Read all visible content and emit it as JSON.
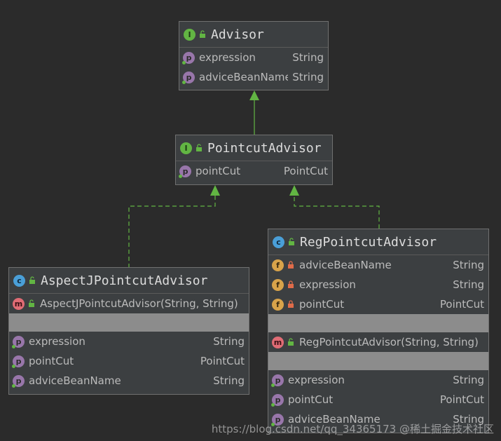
{
  "colors": {
    "background": "#2b2b2b",
    "box_fill": "#3c3f41",
    "connector": "#62b543",
    "interface_badge": "#62b543",
    "class_badge": "#4a9fd8",
    "property_badge": "#9876aa",
    "field_badge": "#d8a34a",
    "method_badge": "#e06c75"
  },
  "advisor": {
    "title": "Advisor",
    "kind_icon": "interface-icon",
    "properties": [
      {
        "name": "expression",
        "type": "String"
      },
      {
        "name": "adviceBeanName",
        "type": "String"
      }
    ]
  },
  "pointcut_advisor": {
    "title": "PointcutAdvisor",
    "kind_icon": "interface-icon",
    "properties": [
      {
        "name": "pointCut",
        "type": "PointCut"
      }
    ]
  },
  "aspectj_advisor": {
    "title": "AspectJPointcutAdvisor",
    "kind_icon": "class-icon",
    "methods": [
      {
        "signature": "AspectJPointcutAdvisor(String, String)"
      }
    ],
    "properties": [
      {
        "name": "expression",
        "type": "String"
      },
      {
        "name": "pointCut",
        "type": "PointCut"
      },
      {
        "name": "adviceBeanName",
        "type": "String"
      }
    ]
  },
  "reg_advisor": {
    "title": "RegPointcutAdvisor",
    "kind_icon": "class-icon",
    "fields": [
      {
        "name": "adviceBeanName",
        "type": "String"
      },
      {
        "name": "expression",
        "type": "String"
      },
      {
        "name": "pointCut",
        "type": "PointCut"
      }
    ],
    "methods": [
      {
        "signature": "RegPointcutAdvisor(String, String)"
      }
    ],
    "properties": [
      {
        "name": "expression",
        "type": "String"
      },
      {
        "name": "pointCut",
        "type": "PointCut"
      },
      {
        "name": "adviceBeanName",
        "type": "String"
      }
    ]
  },
  "relations": [
    {
      "from": "PointcutAdvisor",
      "to": "Advisor",
      "kind": "extends"
    },
    {
      "from": "AspectJPointcutAdvisor",
      "to": "PointcutAdvisor",
      "kind": "implements"
    },
    {
      "from": "RegPointcutAdvisor",
      "to": "PointcutAdvisor",
      "kind": "implements"
    }
  ],
  "badge_letters": {
    "interface": "I",
    "class": "c",
    "property": "p",
    "field": "f",
    "method": "m"
  },
  "watermark": "https://blog.csdn.net/qq_34365173 @稀土掘金技术社区"
}
